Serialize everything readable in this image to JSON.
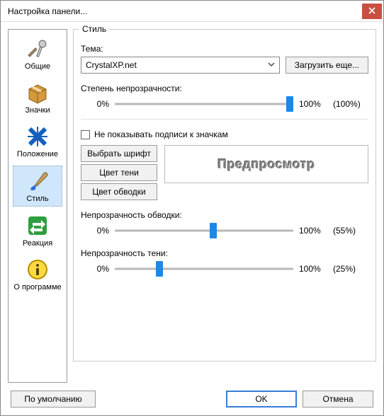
{
  "window": {
    "title": "Настройка панели..."
  },
  "sidebar": {
    "items": [
      {
        "label": "Общие"
      },
      {
        "label": "Значки"
      },
      {
        "label": "Положение"
      },
      {
        "label": "Стиль"
      },
      {
        "label": "Реакция"
      },
      {
        "label": "О программе"
      }
    ]
  },
  "style_group": {
    "legend": "Стиль",
    "theme_label": "Тема:",
    "theme_value": "CrystalXP.net",
    "load_more": "Загрузить еще...",
    "opacity_label": "Степень непрозрачности:",
    "min_pct": "0%",
    "max_pct": "100%",
    "opacity_val": "(100%)",
    "hide_captions": "Не показывать подписи к значкам",
    "font_btn": "Выбрать шрифт",
    "shadow_color_btn": "Цвет тени",
    "stroke_color_btn": "Цвет обводки",
    "preview": "Предпросмотр",
    "stroke_opacity_label": "Непрозрачность обводки:",
    "stroke_opacity_val": "(55%)",
    "shadow_opacity_label": "Непрозрачность тени:",
    "shadow_opacity_val": "(25%)"
  },
  "buttons": {
    "defaults": "По умолчанию",
    "ok": "OK",
    "cancel": "Отмена"
  },
  "slider_pos": {
    "opacity": 98,
    "stroke": 55,
    "shadow": 25
  }
}
